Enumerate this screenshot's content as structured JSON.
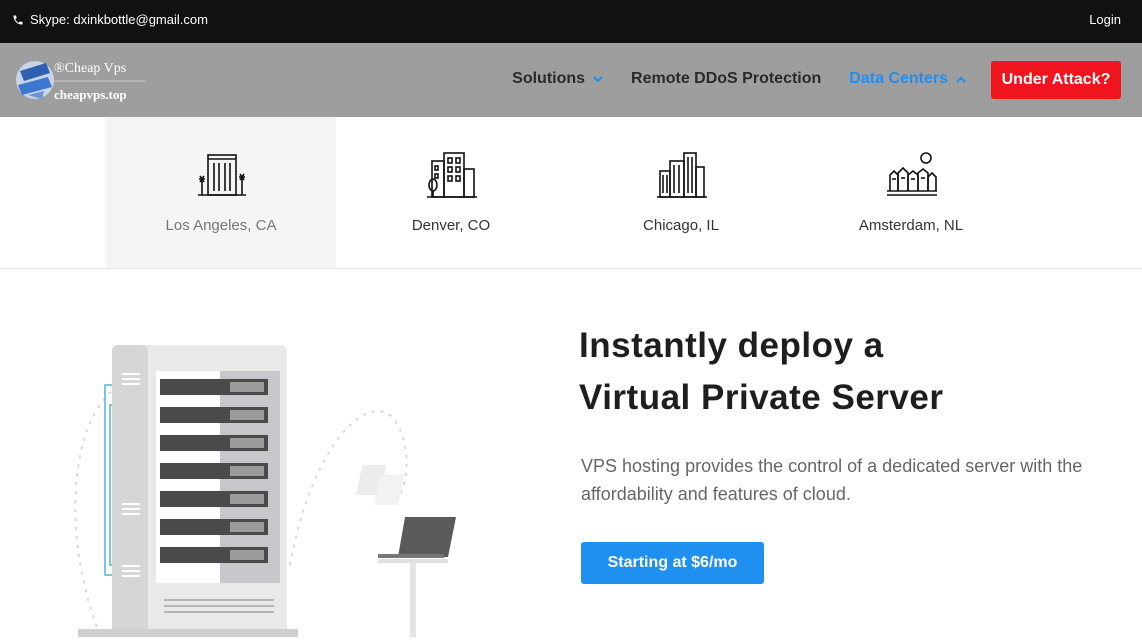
{
  "topbar": {
    "contact_text": "Skype: dxinkbottle@gmail.com",
    "login_label": "Login"
  },
  "nav": {
    "logo_title": "®Cheap Vps",
    "logo_domain": "cheapvps.top",
    "items": [
      {
        "label": "Solutions",
        "active": false,
        "chevron": "chevron-down-icon"
      },
      {
        "label": "Remote DDoS Protection",
        "active": false
      },
      {
        "label": "Data Centers",
        "active": true,
        "chevron": "chevron-up-icon"
      }
    ],
    "attack_button": "Under Attack?"
  },
  "datacenters": [
    {
      "label": "Los Angeles, CA",
      "icon": "los-angeles-building-icon",
      "selected": true
    },
    {
      "label": "Denver, CO",
      "icon": "denver-building-icon",
      "selected": false
    },
    {
      "label": "Chicago, IL",
      "icon": "chicago-building-icon",
      "selected": false
    },
    {
      "label": "Amsterdam, NL",
      "icon": "amsterdam-building-icon",
      "selected": false
    }
  ],
  "hero": {
    "title_line1": "Instantly deploy a",
    "title_line2": "Virtual Private Server",
    "subtitle": "VPS hosting provides the control of a dedicated server with the affordability and features of cloud.",
    "cta_label": "Starting at $6/mo"
  },
  "colors": {
    "accent": "#1f8ff0",
    "attack": "#f0141e",
    "topbar": "#111111",
    "nav": "#9e9e9e"
  }
}
